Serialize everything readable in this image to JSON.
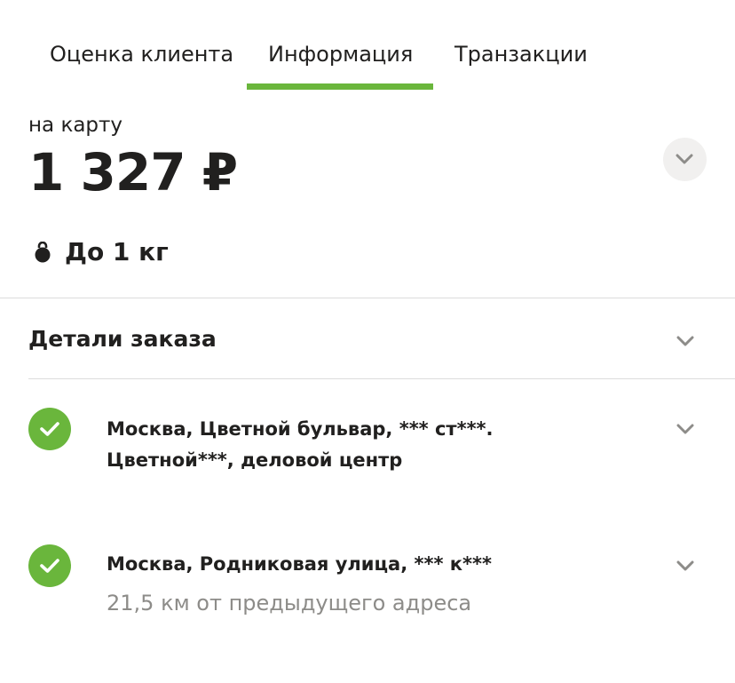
{
  "tabs": [
    {
      "label": "Оценка клиента",
      "active": false
    },
    {
      "label": "Информация",
      "active": true
    },
    {
      "label": "Транзакции",
      "active": false
    }
  ],
  "colors": {
    "accent": "#6ab63c",
    "text": "#21201f",
    "secondary_text": "#8d8c89",
    "divider": "#dcdcdc",
    "circle_bg": "#f1f0ef"
  },
  "payment": {
    "method_label": "на карту",
    "amount": "1 327 ₽",
    "expand_icon": "chevron-down-icon"
  },
  "weight": {
    "icon": "kettlebell-icon",
    "label": "До 1 кг"
  },
  "order_details": {
    "title": "Детали заказа",
    "icon": "chevron-down-icon"
  },
  "addresses": [
    {
      "status_icon": "check-icon",
      "address_line1": "Москва, Цветной бульвар, *** ст***.",
      "address_line2": "Цветной***, деловой центр",
      "note": ""
    },
    {
      "status_icon": "check-icon",
      "address_line1": "Москва, Родниковая улица, *** к***",
      "address_line2": "",
      "note": "21,5 км от предыдущего адреса"
    }
  ]
}
